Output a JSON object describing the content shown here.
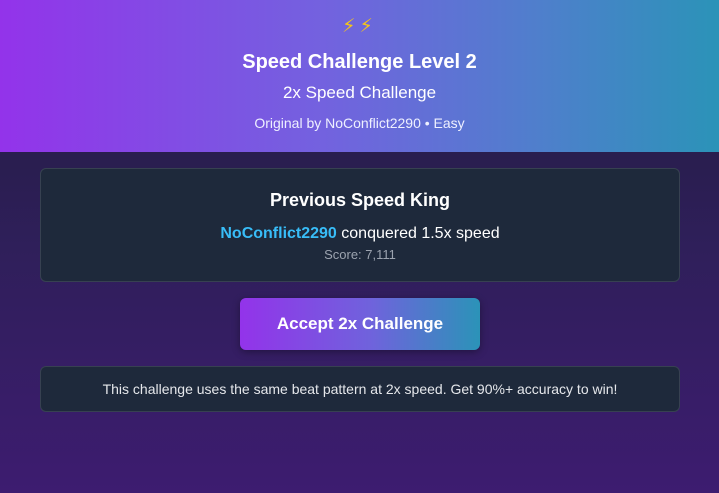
{
  "header": {
    "icons": [
      "lightning-bolt",
      "lightning-bolt"
    ],
    "icon_glyphs": "⚡⚡",
    "title": "Speed Challenge Level 2",
    "subtitle": "2x Speed Challenge",
    "meta": "Original by NoConflict2290 • Easy"
  },
  "previous_king": {
    "heading": "Previous Speed King",
    "player": "NoConflict2290",
    "achievement": " conquered 1.5x speed",
    "score": "Score: 7,111"
  },
  "accept_button": {
    "label": "Accept 2x Challenge"
  },
  "info": {
    "text": "This challenge uses the same beat pattern at 2x speed. Get 90%+ accuracy to win!"
  },
  "colors": {
    "header_gradient_start": "#9333ea",
    "header_gradient_end": "#2b93b8",
    "card_background": "#1e293b",
    "player_name": "#38bdf8",
    "score_text": "#9ca3af",
    "lightning": "#f5c518"
  }
}
